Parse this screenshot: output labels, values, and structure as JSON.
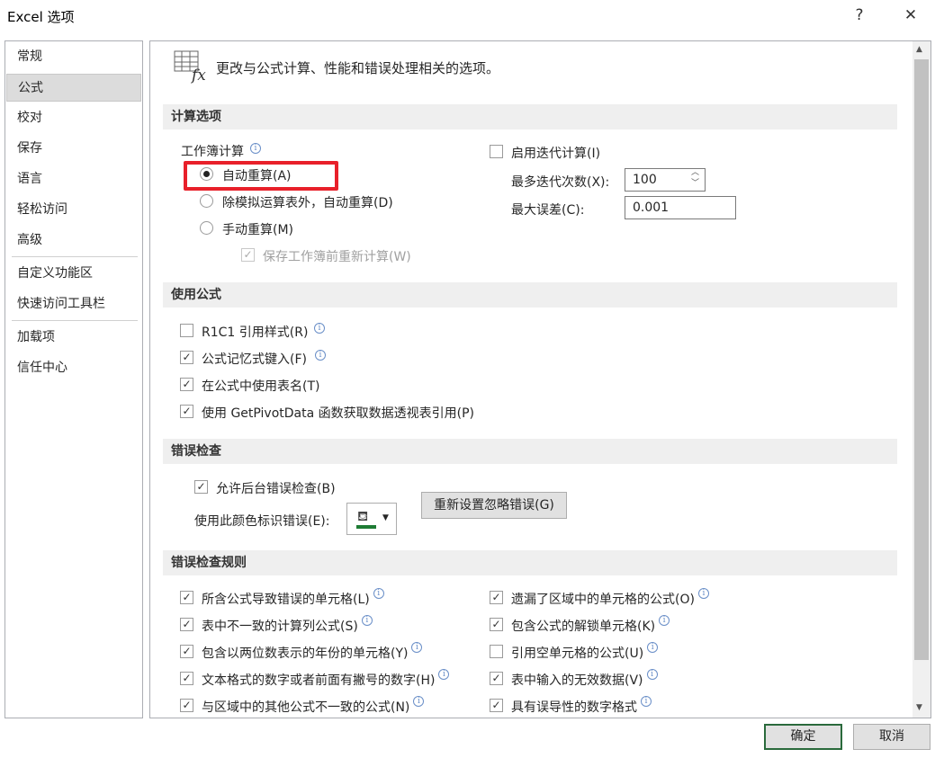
{
  "window": {
    "title": "Excel 选项",
    "help": "?",
    "close": "✕"
  },
  "nav": {
    "items": [
      "常规",
      "公式",
      "校对",
      "保存",
      "语言",
      "轻松访问",
      "高级",
      "自定义功能区",
      "快速访问工具栏",
      "加载项",
      "信任中心"
    ],
    "selected": "公式"
  },
  "header": {
    "text": "更改与公式计算、性能和错误处理相关的选项。",
    "icon": "fx"
  },
  "calc": {
    "title": "计算选项",
    "workbook_label": "工作簿计算",
    "auto": "自动重算(A)",
    "auto_except": "除模拟运算表外，自动重算(D)",
    "manual": "手动重算(M)",
    "save_recalc": "保存工作簿前重新计算(W)",
    "iterative": "启用迭代计算(I)",
    "max_iter_label": "最多迭代次数(X):",
    "max_iter": "100",
    "max_change_label": "最大误差(C):",
    "max_change": "0.001"
  },
  "formulas": {
    "title": "使用公式",
    "r1c1": "R1C1 引用样式(R)",
    "autocomplete": "公式记忆式键入(F)",
    "table_names": "在公式中使用表名(T)",
    "getpivot": "使用 GetPivotData 函数获取数据透视表引用(P)"
  },
  "errcheck": {
    "title": "错误检查",
    "background": "允许后台错误检查(B)",
    "color_label": "使用此颜色标识错误(E):",
    "reset": "重新设置忽略错误(G)",
    "accent": "#1e7b34"
  },
  "rules": {
    "title": "错误检查规则",
    "left": [
      {
        "label": "所含公式导致错误的单元格(L)",
        "checked": true
      },
      {
        "label": "表中不一致的计算列公式(S)",
        "checked": true
      },
      {
        "label": "包含以两位数表示的年份的单元格(Y)",
        "checked": true
      },
      {
        "label": "文本格式的数字或者前面有撇号的数字(H)",
        "checked": true
      },
      {
        "label": "与区域中的其他公式不一致的公式(N)",
        "checked": true
      }
    ],
    "right": [
      {
        "label": "遗漏了区域中的单元格的公式(O)",
        "checked": true
      },
      {
        "label": "包含公式的解锁单元格(K)",
        "checked": true
      },
      {
        "label": "引用空单元格的公式(U)",
        "checked": false
      },
      {
        "label": "表中输入的无效数据(V)",
        "checked": true
      },
      {
        "label": "具有误导性的数字格式",
        "checked": true
      }
    ]
  },
  "footer": {
    "ok": "确定",
    "cancel": "取消"
  },
  "highlight_color": "#e8202a"
}
